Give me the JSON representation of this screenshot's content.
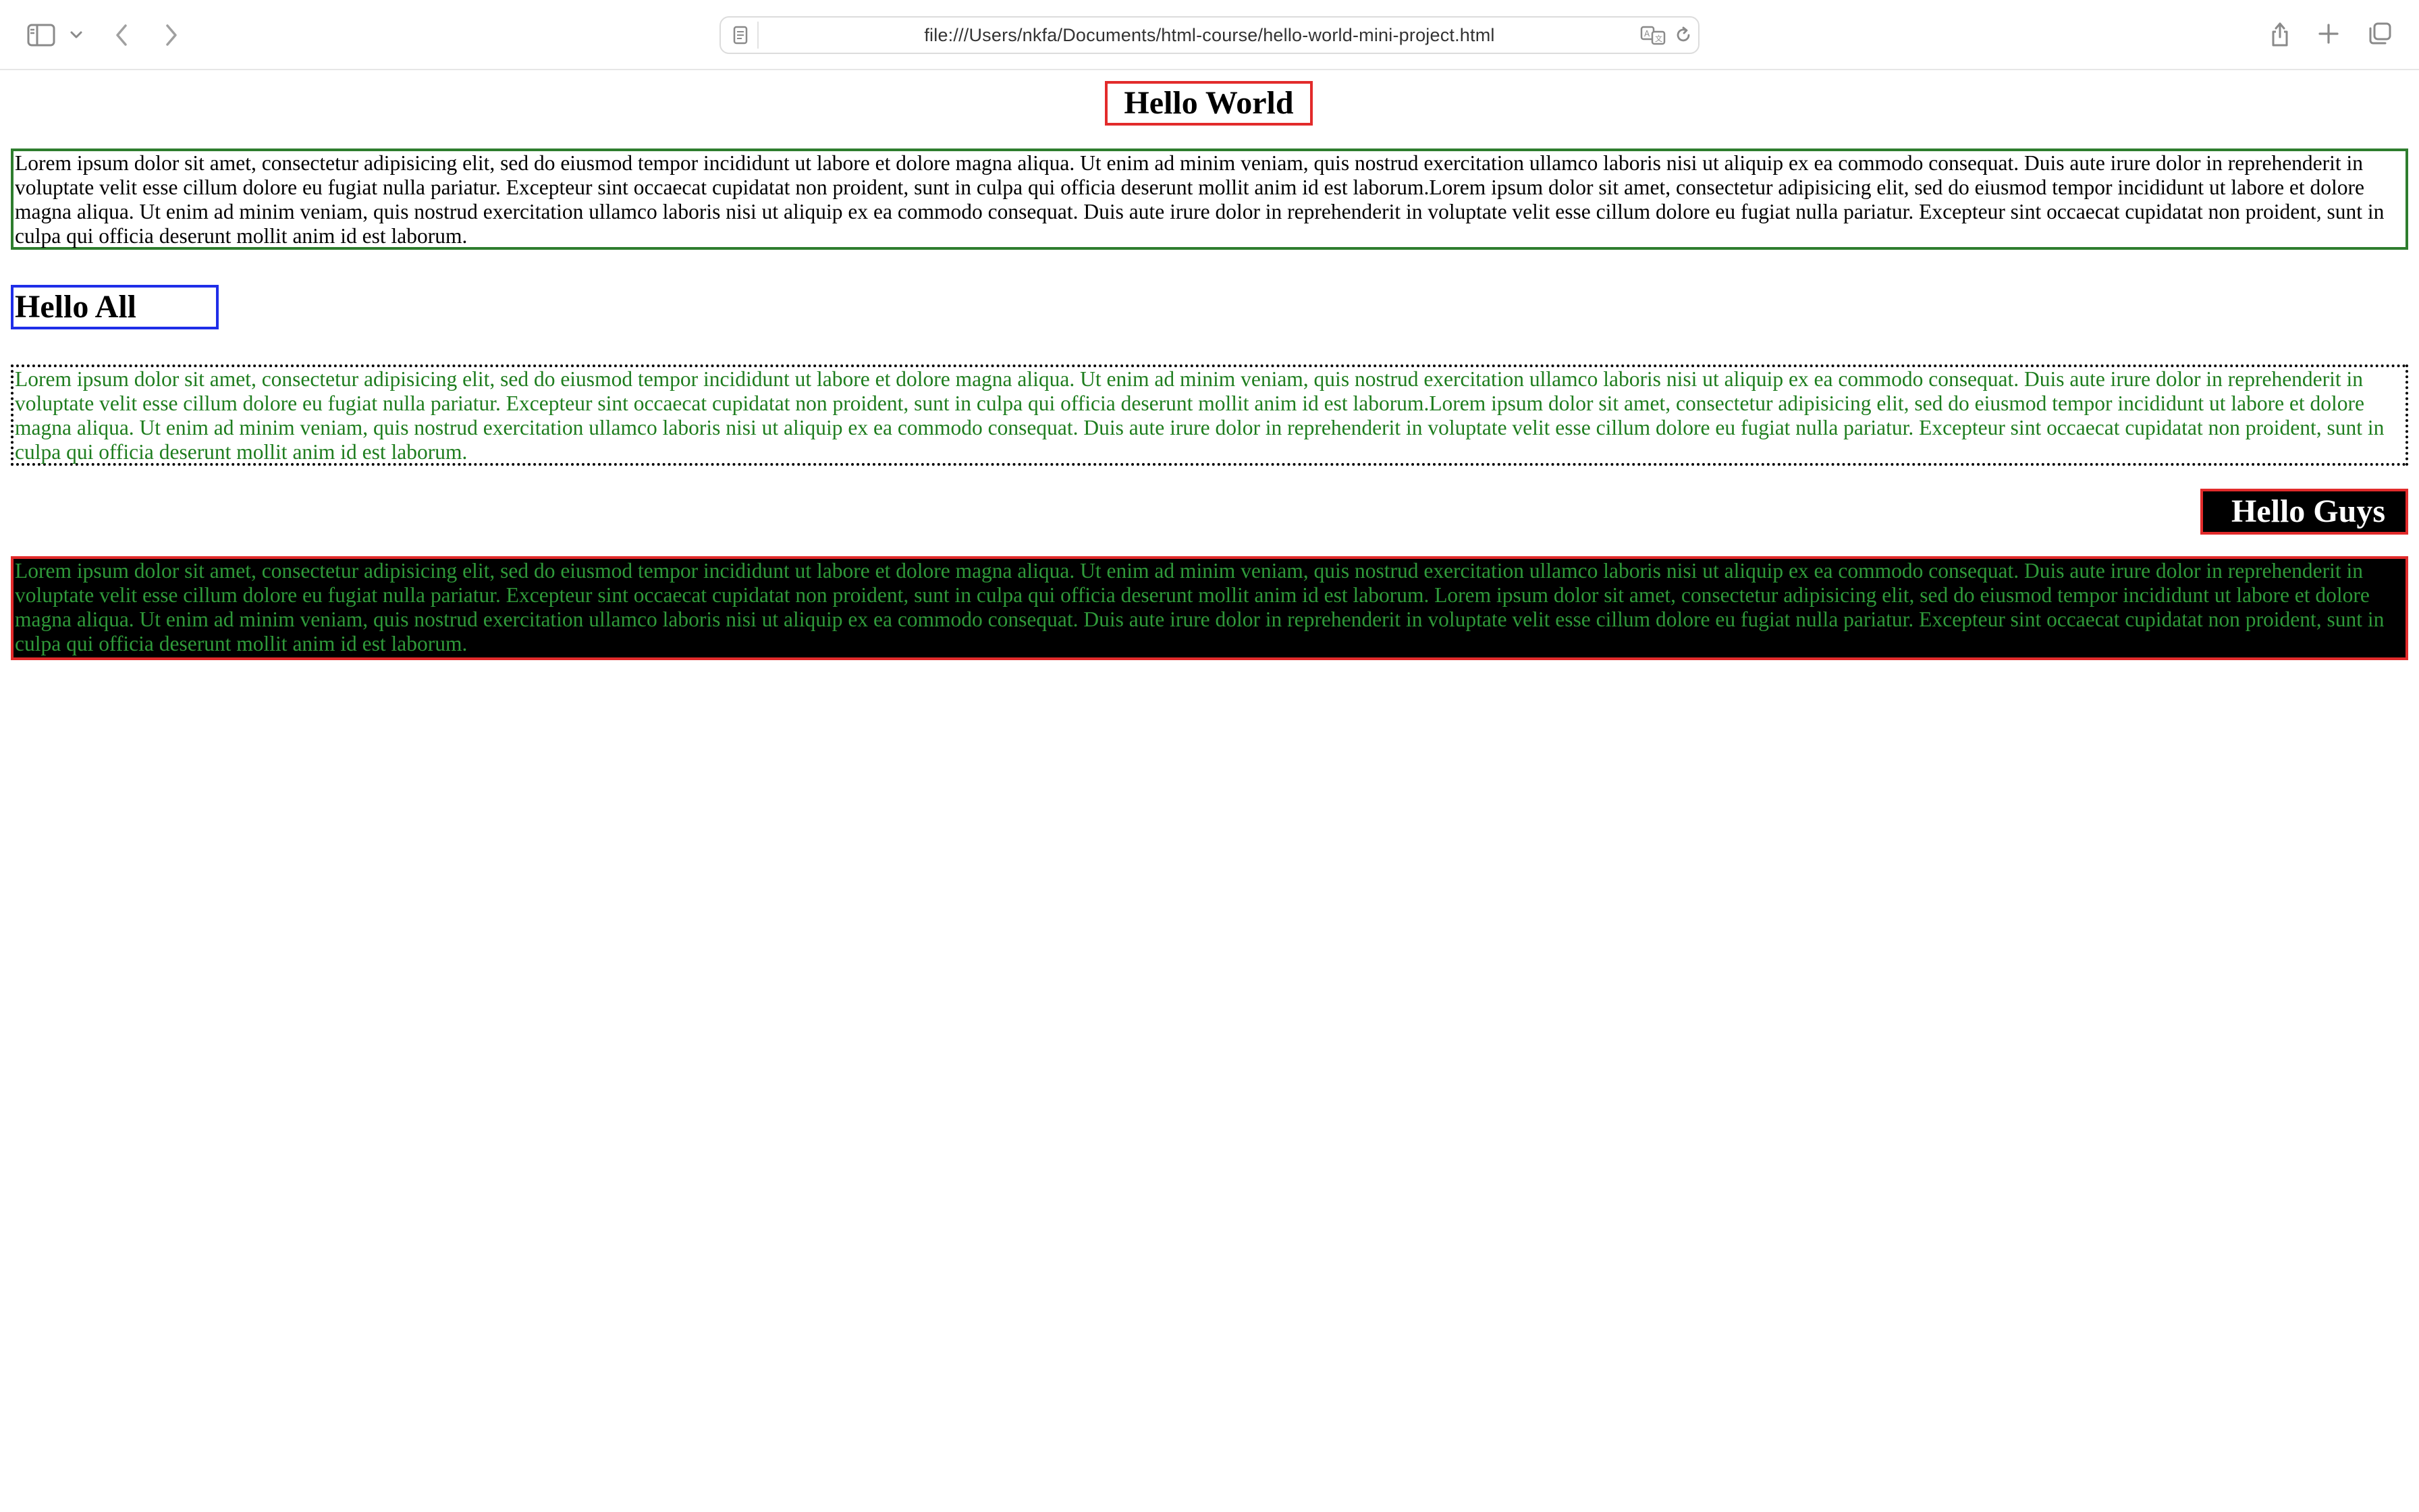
{
  "browser": {
    "url": "file:///Users/nkfa/Documents/html-course/hello-world-mini-project.html",
    "icons": [
      "sidebar-icon",
      "chevron-down-icon",
      "back-icon",
      "forward-icon",
      "page-icon",
      "translate-icon",
      "reload-icon",
      "share-icon",
      "new-tab-icon",
      "tabs-overview-icon"
    ]
  },
  "content": {
    "heading1": "Hello World",
    "paragraph1": "Lorem ipsum dolor sit amet, consectetur adipisicing elit, sed do eiusmod tempor incididunt ut labore et dolore magna aliqua. Ut enim ad minim veniam, quis nostrud exercitation ullamco laboris nisi ut aliquip ex ea commodo consequat. Duis aute irure dolor in reprehenderit in voluptate velit esse cillum dolore eu fugiat nulla pariatur. Excepteur sint occaecat cupidatat non proident, sunt in culpa qui officia deserunt mollit anim id est laborum.Lorem ipsum dolor sit amet, consectetur adipisicing elit, sed do eiusmod tempor incididunt ut labore et dolore magna aliqua. Ut enim ad minim veniam, quis nostrud exercitation ullamco laboris nisi ut aliquip ex ea commodo consequat. Duis aute irure dolor in reprehenderit in voluptate velit esse cillum dolore eu fugiat nulla pariatur. Excepteur sint occaecat cupidatat non proident, sunt in culpa qui officia deserunt mollit anim id est laborum.",
    "heading2": "Hello All",
    "paragraph2": "Lorem ipsum dolor sit amet, consectetur adipisicing elit, sed do eiusmod tempor incididunt ut labore et dolore magna aliqua. Ut enim ad minim veniam, quis nostrud exercitation ullamco laboris nisi ut aliquip ex ea commodo consequat. Duis aute irure dolor in reprehenderit in voluptate velit esse cillum dolore eu fugiat nulla pariatur. Excepteur sint occaecat cupidatat non proident, sunt in culpa qui officia deserunt mollit anim id est laborum.Lorem ipsum dolor sit amet, consectetur adipisicing elit, sed do eiusmod tempor incididunt ut labore et dolore magna aliqua. Ut enim ad minim veniam, quis nostrud exercitation ullamco laboris nisi ut aliquip ex ea commodo consequat. Duis aute irure dolor in reprehenderit in voluptate velit esse cillum dolore eu fugiat nulla pariatur. Excepteur sint occaecat cupidatat non proident, sunt in culpa qui officia deserunt mollit anim id est laborum.",
    "heading3": "Hello Guys",
    "paragraph3": "Lorem ipsum dolor sit amet, consectetur adipisicing elit, sed do eiusmod tempor incididunt ut labore et dolore magna aliqua. Ut enim ad minim veniam, quis nostrud exercitation ullamco laboris nisi ut aliquip ex ea commodo consequat. Duis aute irure dolor in reprehenderit in voluptate velit esse cillum dolore eu fugiat nulla pariatur. Excepteur sint occaecat cupidatat non proident, sunt in culpa qui officia deserunt mollit anim id est laborum. Lorem ipsum dolor sit amet, consectetur adipisicing elit, sed do eiusmod tempor incididunt ut labore et dolore magna aliqua. Ut enim ad minim veniam, quis nostrud exercitation ullamco laboris nisi ut aliquip ex ea commodo consequat. Duis aute irure dolor in reprehenderit in voluptate velit esse cillum dolore eu fugiat nulla pariatur. Excepteur sint occaecat cupidatat non proident, sunt in culpa qui officia deserunt mollit anim id est laborum."
  },
  "colors": {
    "red_border": "#e22b2b",
    "green_border": "#2e7d2e",
    "blue_border": "#1f2ee8",
    "green_text": "#1e7d1e",
    "black_bg": "#000000"
  }
}
